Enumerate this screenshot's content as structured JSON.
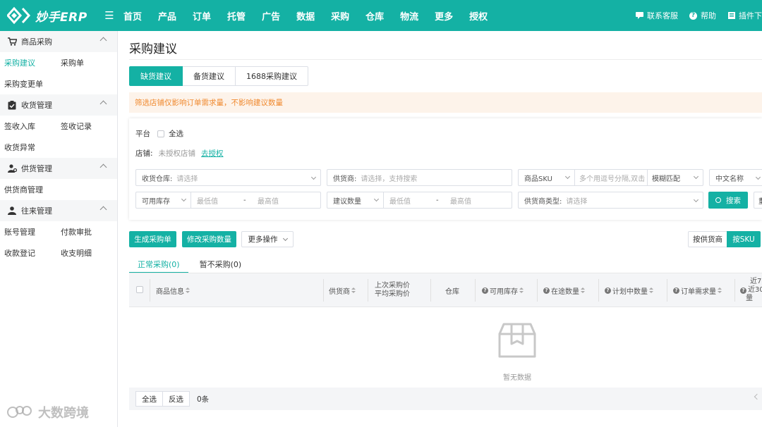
{
  "app": {
    "logo_text": "妙手ERP",
    "accent_color": "#14b1a4"
  },
  "topnav": {
    "items": [
      "首页",
      "产品",
      "订单",
      "托管",
      "广告",
      "数据",
      "采购",
      "仓库",
      "物流",
      "更多",
      "授权"
    ],
    "contact": "联系客服",
    "help": "帮助",
    "plugin": "插件下"
  },
  "sidebar": {
    "groups": [
      {
        "title": "商品采购",
        "icon": "cart-icon",
        "links": [
          "采购建议",
          "采购单",
          "采购变更单"
        ]
      },
      {
        "title": "收货管理",
        "icon": "clipboard-check-icon",
        "links": [
          "签收入库",
          "签收记录",
          "收货异常"
        ]
      },
      {
        "title": "供货管理",
        "icon": "supplier-icon",
        "links": [
          "供货商管理"
        ]
      },
      {
        "title": "往来管理",
        "icon": "user-icon",
        "links": [
          "账号管理",
          "付款审批",
          "收款登记",
          "收支明细"
        ]
      }
    ],
    "active_link": "采购建议"
  },
  "page": {
    "title": "采购建议",
    "tabs": [
      "缺货建议",
      "备货建议",
      "1688采购建议"
    ],
    "active_tab": "缺货建议",
    "notice": "筛选店铺仅影响订单需求量，不影响建议数量"
  },
  "filters": {
    "platform_label": "平台",
    "select_all": "全选",
    "store_label": "店铺:",
    "store_value": "未授权店铺",
    "store_link": "去授权",
    "warehouse_label": "收货仓库:",
    "warehouse_placeholder": "请选择",
    "supplier_label": "供货商:",
    "supplier_placeholder": "请选择，支持搜索",
    "sku_select": "商品SKU",
    "sku_placeholder": "多个用逗号分隔,双击",
    "match_mode": "模糊匹配",
    "name_lang": "中文名称",
    "stock_select": "可用库存",
    "min_placeholder": "最低值",
    "max_placeholder": "最高值",
    "range_dash": "-",
    "suggest_select": "建议数量",
    "supplier_type_label": "供货商类型:",
    "supplier_type_placeholder": "请选择",
    "search_button": "搜索",
    "cut_button": "重"
  },
  "actions": {
    "generate": "生成采购单",
    "modify": "修改采购数量",
    "more": "更多操作",
    "by_supplier": "按供货商",
    "by_sku": "按SKU"
  },
  "subtabs": {
    "normal": "正常采购(0)",
    "paused": "暂不采购(0)"
  },
  "table": {
    "columns": {
      "product": "商品信息",
      "supplier": "供货商",
      "last_price_1": "上次采购价",
      "last_price_2": "平均采购价",
      "warehouse": "仓库",
      "available": "可用库存",
      "transit": "在途数量",
      "planned": "计划中数量",
      "demand": "订单需求量",
      "recent_1": "近7",
      "recent_2": "近30",
      "recent_3": "量"
    },
    "empty_text": "暂无数据"
  },
  "footer": {
    "select_all": "全选",
    "invert": "反选",
    "count": "0条"
  },
  "watermark": "大数跨境"
}
